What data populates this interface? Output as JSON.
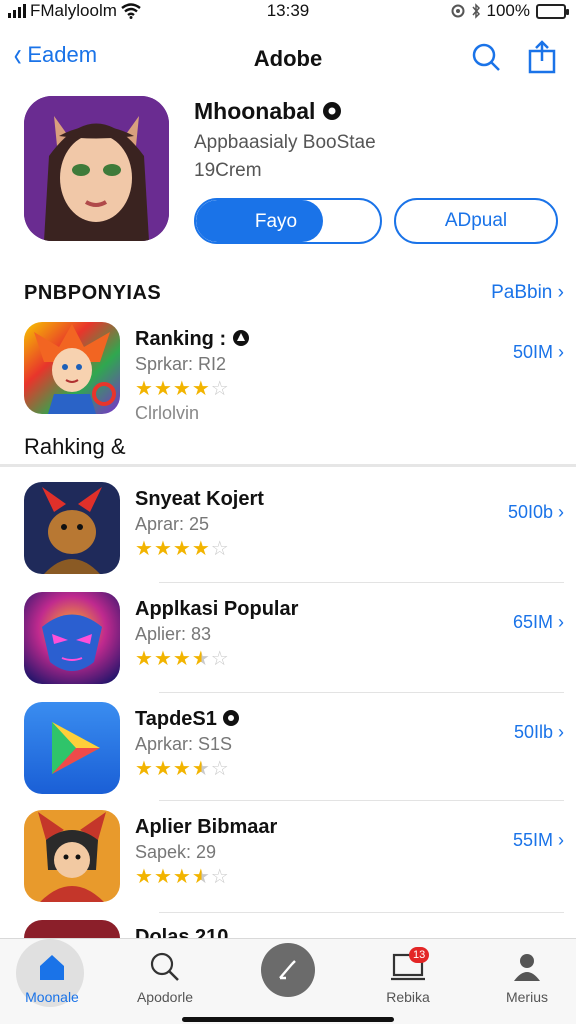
{
  "status": {
    "carrier": "FMalyloolm",
    "time": "13:39",
    "battery": "100%",
    "battery_level": 1.0
  },
  "nav": {
    "back_label": "Eadem",
    "title": "Adobe",
    "icons": [
      "search-icon",
      "share-icon"
    ]
  },
  "featured": {
    "name": "Mhoonabal",
    "subtitle": "Appbaasialy BooStae",
    "meta": "19Crem",
    "primary_button": "Fayo",
    "secondary_button": "ADpual"
  },
  "section": {
    "title": "PNBPONYIAS",
    "more": "PaBbin"
  },
  "first_app": {
    "name": "Ranking",
    "subtitle": "Sprkar: RI2",
    "rating": 4,
    "size": "50IM",
    "extra": "Clrlolvin",
    "icon": "colorful-character-icon"
  },
  "ranking_label": "Rahking &",
  "apps": [
    {
      "name": "Snyeat Kojert",
      "subtitle": "Aprar: 25",
      "rating": 4,
      "size": "50I0b",
      "icon": "horned-creature-icon"
    },
    {
      "name": "Applkasi Popular",
      "subtitle": "Aplier: 83",
      "rating": 3.5,
      "size": "65IM",
      "icon": "glowing-mask-icon"
    },
    {
      "name": "TapdeS1",
      "subtitle": "Aprkar: S1S",
      "rating": 3.5,
      "size": "50Ilb",
      "icon": "play-triangle-icon"
    },
    {
      "name": "Aplier Bibmaar",
      "subtitle": "Sapek: 29",
      "rating": 3.5,
      "size": "55IM",
      "icon": "ninja-fox-icon"
    }
  ],
  "partial_app_name": "Dolas 210",
  "tabs": [
    {
      "label": "Moonale",
      "icon": "home-icon",
      "active": true
    },
    {
      "label": "Apodorle",
      "icon": "search-icon",
      "active": false
    },
    {
      "label": "",
      "icon": "pencil-icon",
      "active": false
    },
    {
      "label": "Rebika",
      "icon": "updates-icon",
      "active": false,
      "badge": "13"
    },
    {
      "label": "Merius",
      "icon": "profile-icon",
      "active": false
    }
  ],
  "colors": {
    "accent": "#1a73e8",
    "star": "#f2b400",
    "badge": "#e32626"
  }
}
